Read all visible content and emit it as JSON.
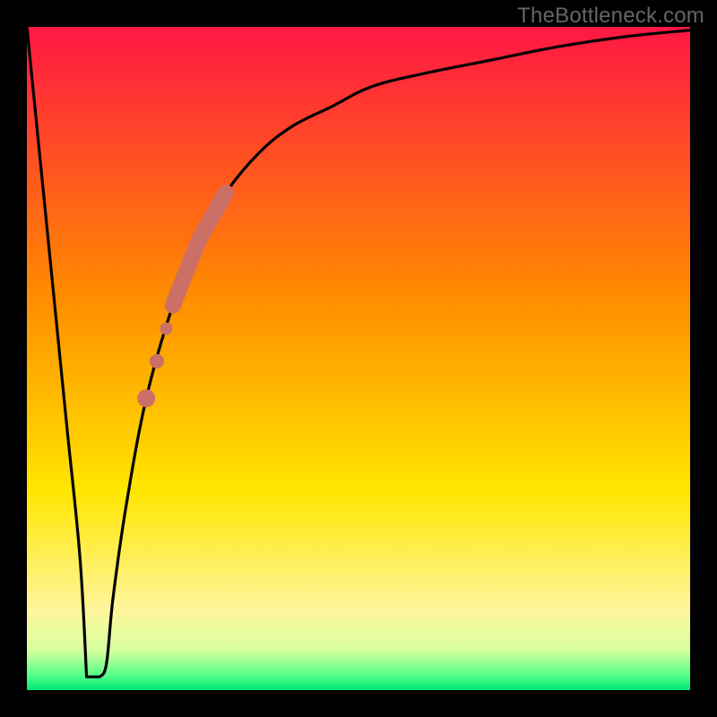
{
  "watermark": {
    "text": "TheBottleneck.com"
  },
  "chart_data": {
    "type": "line",
    "title": "",
    "xlabel": "",
    "ylabel": "",
    "xlim": [
      0,
      100
    ],
    "ylim": [
      0,
      100
    ],
    "background_gradient_stops": [
      {
        "pct": 0.0,
        "color": "#ff1744"
      },
      {
        "pct": 0.4,
        "color": "#ff8a00"
      },
      {
        "pct": 0.7,
        "color": "#ffe600"
      },
      {
        "pct": 0.88,
        "color": "#fff59d"
      },
      {
        "pct": 0.94,
        "color": "#d7ff9e"
      },
      {
        "pct": 0.98,
        "color": "#4dff88"
      },
      {
        "pct": 1.0,
        "color": "#00e676"
      }
    ],
    "series": [
      {
        "name": "bottleneck-curve",
        "x": [
          0,
          2,
          4,
          6,
          8,
          9,
          10,
          11,
          12,
          13,
          15,
          18,
          22,
          26,
          30,
          35,
          40,
          46,
          52,
          60,
          70,
          80,
          90,
          100
        ],
        "y": [
          100,
          80,
          60,
          40,
          20,
          4,
          2,
          2,
          4,
          14,
          28,
          44,
          58,
          68,
          75,
          81,
          85,
          88,
          91,
          93,
          95,
          97,
          98.5,
          99.5
        ]
      }
    ],
    "min_notch": {
      "x_start": 9,
      "x_end": 11,
      "y": 2
    },
    "highlight_band": {
      "name": "salmon-segment",
      "color": "#cc6f66",
      "thick": {
        "x_start": 22,
        "x_end": 30
      },
      "dots": [
        {
          "x": 21.0,
          "r": 7
        },
        {
          "x": 19.6,
          "r": 8
        },
        {
          "x": 18.0,
          "r": 10
        }
      ]
    }
  }
}
